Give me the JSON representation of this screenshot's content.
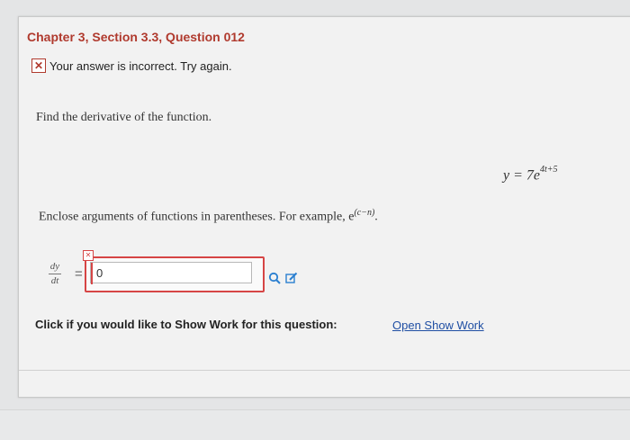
{
  "header": {
    "title": "Chapter 3, Section 3.3, Question 012"
  },
  "feedback": {
    "icon": "x-mark-icon",
    "message": "Your answer is incorrect.  Try again."
  },
  "question": {
    "instruction": "Find the derivative of the function.",
    "equation_lhs": "y = 7e",
    "equation_exponent": "4t+5",
    "parentheses_note": "Enclose arguments of functions in parentheses. For example, e",
    "example_exponent": "(c−n)",
    "example_end": "."
  },
  "answer": {
    "derivative_num": "dy",
    "derivative_den": "dt",
    "equals": "=",
    "value": "0",
    "status_color": "#d64545"
  },
  "show_work": {
    "prompt": "Click if you would like to Show Work for this question:",
    "link": "Open Show Work"
  },
  "colors": {
    "title": "#b03a2e",
    "link": "#1f4ea3"
  }
}
